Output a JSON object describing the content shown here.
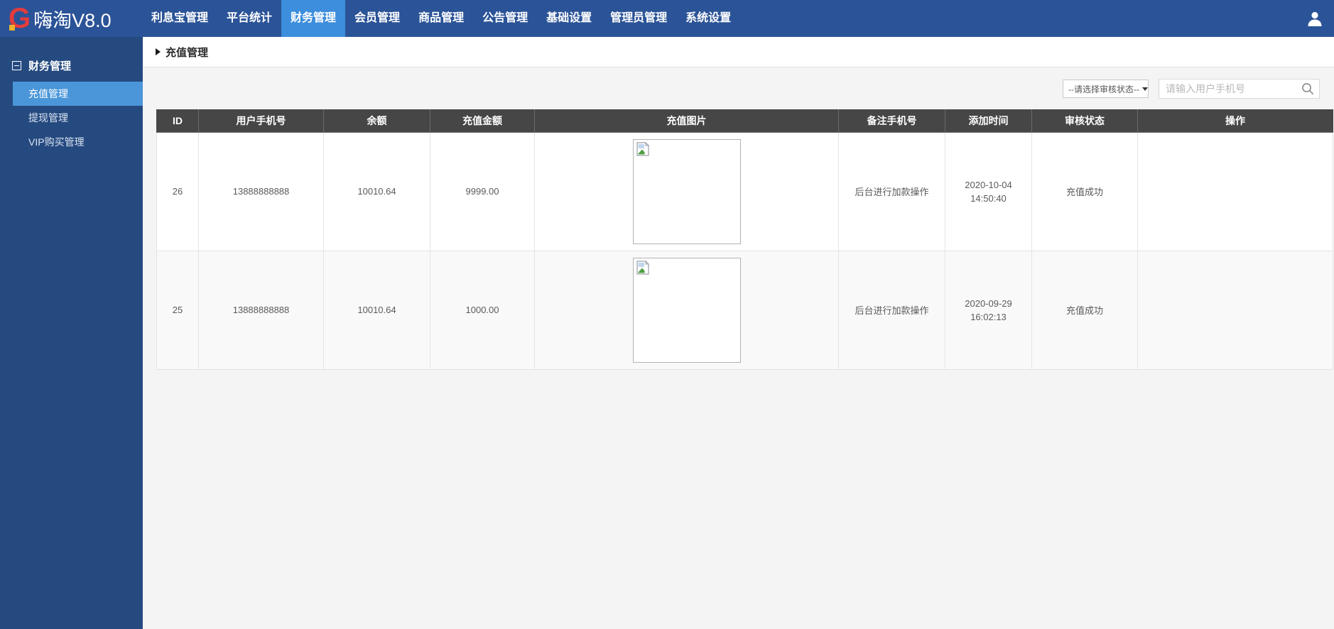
{
  "topnav": {
    "logo": {
      "letter": "G",
      "title": "嗨淘V8.0"
    },
    "items": [
      {
        "label": "利息宝管理",
        "active": false
      },
      {
        "label": "平台统计",
        "active": false
      },
      {
        "label": "财务管理",
        "active": true
      },
      {
        "label": "会员管理",
        "active": false
      },
      {
        "label": "商品管理",
        "active": false
      },
      {
        "label": "公告管理",
        "active": false
      },
      {
        "label": "基础设置",
        "active": false
      },
      {
        "label": "管理员管理",
        "active": false
      },
      {
        "label": "系统设置",
        "active": false
      }
    ],
    "user_icon": "user-icon"
  },
  "sidebar": {
    "section": {
      "label": "财务管理",
      "collapse_icon": "minus-square-icon"
    },
    "items": [
      {
        "label": "充值管理",
        "active": true
      },
      {
        "label": "提现管理",
        "active": false
      },
      {
        "label": "VIP购买管理",
        "active": false
      }
    ]
  },
  "breadcrumb": {
    "title": "充值管理",
    "arrow_icon": "triangle-right-icon"
  },
  "filters": {
    "status_select_value": "--请选择审核状态--",
    "search_placeholder": "请输入用户手机号",
    "search_icon": "search-icon"
  },
  "table": {
    "columns": [
      "ID",
      "用户手机号",
      "余额",
      "充值金额",
      "充值图片",
      "备注手机号",
      "添加时间",
      "审核状态",
      "操作"
    ],
    "rows": [
      {
        "id": "26",
        "phone": "13888888888",
        "balance": "10010.64",
        "amount": "9999.00",
        "image_icon": "broken-image-icon",
        "note": "后台进行加款操作",
        "date": "2020-10-04",
        "time": "14:50:40",
        "status": "充值成功",
        "actions": ""
      },
      {
        "id": "25",
        "phone": "13888888888",
        "balance": "10010.64",
        "amount": "1000.00",
        "image_icon": "broken-image-icon",
        "note": "后台进行加款操作",
        "date": "2020-09-29",
        "time": "16:02:13",
        "status": "充值成功",
        "actions": ""
      }
    ]
  },
  "colors": {
    "navbar_bg": "#2b5397",
    "nav_active_bg": "#3d8edc",
    "sidebar_bg": "#254a80",
    "sidebar_active_bg": "#4a96d8",
    "logo_red": "#e23c3c",
    "logo_accent_yellow": "#f0b32a",
    "table_header_bg": "#464646",
    "content_bg": "#f4f4f4",
    "alt_row_bg": "#f9f9f9"
  }
}
